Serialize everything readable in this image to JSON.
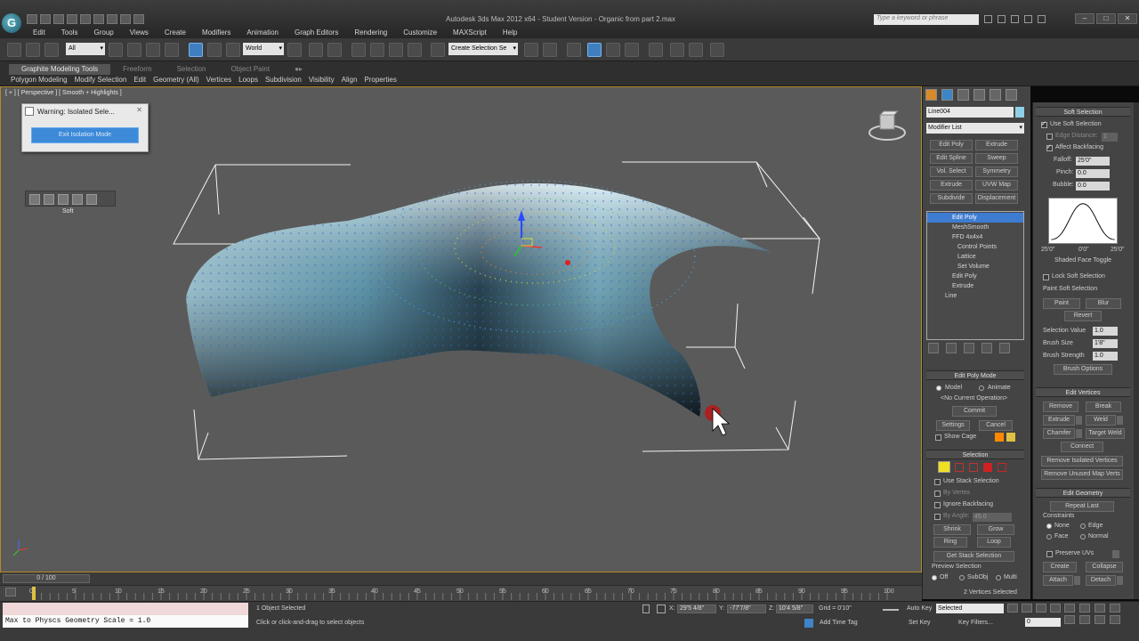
{
  "window": {
    "title": "Autodesk 3ds Max 2012 x64  -  Student Version  -  Organic from part 2.max",
    "search_placeholder": "Type a keyword or phrase",
    "logo_letter": "G"
  },
  "menu": [
    "Edit",
    "Tools",
    "Group",
    "Views",
    "Create",
    "Modifiers",
    "Animation",
    "Graph Editors",
    "Rendering",
    "Customize",
    "MAXScript",
    "Help"
  ],
  "toolbar": {
    "selection_filter": "All",
    "ref_coord": "World",
    "named_selection": "Create Selection Se"
  },
  "ribbon": {
    "tabs": [
      "Graphite Modeling Tools",
      "Freeform",
      "Selection",
      "Object Paint"
    ],
    "active_tab": 0,
    "subtabs": [
      "Polygon Modeling",
      "Modify Selection",
      "Edit",
      "Geometry (All)",
      "Vertices",
      "Loops",
      "Subdivision",
      "Visibility",
      "Align",
      "Properties"
    ]
  },
  "viewport": {
    "label": "[ + ] [ Perspective ] [ Smooth + Highlights ]",
    "warning_title": "Warning: Isolated Sele...",
    "exit_isolation": "Exit Isolation Mode",
    "soft_label": "Soft"
  },
  "modify_panel": {
    "object_name": "Line004",
    "object_color": "#8fd0e6",
    "modifier_list": "Modifier List",
    "mod_buttons": [
      "Edit Poly",
      "Extrude",
      "Edit Spline",
      "Sweep",
      "Vol. Select",
      "Symmetry",
      "Extrude",
      "UVW Map",
      "Subdivide",
      "Displacement"
    ],
    "stack": [
      {
        "label": "Edit Poly",
        "selected": true,
        "indent": 0
      },
      {
        "label": "MeshSmooth",
        "selected": false,
        "indent": 0
      },
      {
        "label": "FFD 4x4x4",
        "selected": false,
        "indent": 0
      },
      {
        "label": "Control Points",
        "selected": false,
        "indent": 1
      },
      {
        "label": "Lattice",
        "selected": false,
        "indent": 1
      },
      {
        "label": "Set Volume",
        "selected": false,
        "indent": 1
      },
      {
        "label": "Edit Poly",
        "selected": false,
        "indent": 0
      },
      {
        "label": "Extrude",
        "selected": false,
        "indent": 0
      },
      {
        "label": "Line",
        "selected": false,
        "indent": 0
      }
    ],
    "edit_poly_mode": {
      "header": "Edit Poly Mode",
      "model": "Model",
      "animate": "Animate",
      "current_op": "<No Current Operation>",
      "commit": "Commit",
      "settings": "Settings",
      "cancel": "Cancel",
      "show_cage": "Show Cage",
      "cage_color1": "#ff8800",
      "cage_color2": "#e0c040"
    },
    "selection": {
      "header": "Selection",
      "use_stack": "Use Stack Selection",
      "by_vertex": "By Vertex",
      "ignore_backfacing": "Ignore Backfacing",
      "by_angle": "By Angle:",
      "by_angle_value": "45.0",
      "shrink": "Shrink",
      "grow": "Grow",
      "ring": "Ring",
      "loop": "Loop",
      "get_stack": "Get Stack Selection",
      "preview": "Preview Selection",
      "off": "Off",
      "subobj": "SubObj",
      "multi": "Multi",
      "status": "2 Vertices Selected"
    }
  },
  "soft_selection": {
    "header": "Soft Selection",
    "use_soft": "Use Soft Selection",
    "edge_distance": "Edge Distance:",
    "edge_distance_value": "1",
    "affect_backfacing": "Affect Backfacing",
    "falloff_label": "Falloff:",
    "falloff": "25'0\"",
    "pinch_label": "Pinch:",
    "pinch": "0.0",
    "bubble_label": "Bubble:",
    "bubble": "0.0",
    "curve_labels": [
      "25'0\"",
      "0'0\"",
      "25'0\""
    ],
    "shaded_face_toggle": "Shaded Face Toggle",
    "lock_soft": "Lock Soft Selection",
    "paint_header": "Paint Soft Selection",
    "paint": "Paint",
    "blur": "Blur",
    "revert": "Revert",
    "selection_value_label": "Selection Value",
    "selection_value": "1.0",
    "brush_size_label": "Brush Size",
    "brush_size": "1'8\"",
    "brush_strength_label": "Brush Strength",
    "brush_strength": "1.0",
    "brush_options": "Brush Options"
  },
  "edit_vertices": {
    "header": "Edit Vertices",
    "remove": "Remove",
    "break": "Break",
    "extrude": "Extrude",
    "weld": "Weld",
    "chamfer": "Chamfer",
    "target_weld": "Target Weld",
    "connect": "Connect",
    "remove_isolated": "Remove Isolated Vertices",
    "remove_unused": "Remove Unused Map Verts"
  },
  "edit_geometry": {
    "header": "Edit Geometry",
    "repeat_last": "Repeat Last",
    "constraints": "Constraints",
    "none": "None",
    "edge": "Edge",
    "face": "Face",
    "normal": "Normal",
    "preserve_uvs": "Preserve UVs",
    "create": "Create",
    "collapse": "Collapse",
    "attach": "Attach",
    "detach": "Detach"
  },
  "timeline": {
    "position": "0 / 100",
    "ticks": [
      "0",
      "5",
      "10",
      "15",
      "20",
      "25",
      "30",
      "35",
      "40",
      "45",
      "50",
      "55",
      "60",
      "65",
      "70",
      "75",
      "80",
      "85",
      "90",
      "95",
      "100"
    ]
  },
  "status": {
    "maxscript_output": "Max to Physcs Geometry Scale = 1.0",
    "objects_selected": "1 Object Selected",
    "prompt": "Click or click-and-drag to select objects",
    "x_label": "X:",
    "x": "29'5 4/8\"",
    "y_label": "Y:",
    "y": "-77'7/8\"",
    "z_label": "Z:",
    "z": "10'4 5/8\"",
    "grid": "Grid = 0'10\"",
    "add_time_tag": "Add Time Tag",
    "auto_key": "Auto Key",
    "set_key": "Set Key",
    "key_mode": "Selected",
    "key_filters": "Key Filters...",
    "frame": "0"
  }
}
